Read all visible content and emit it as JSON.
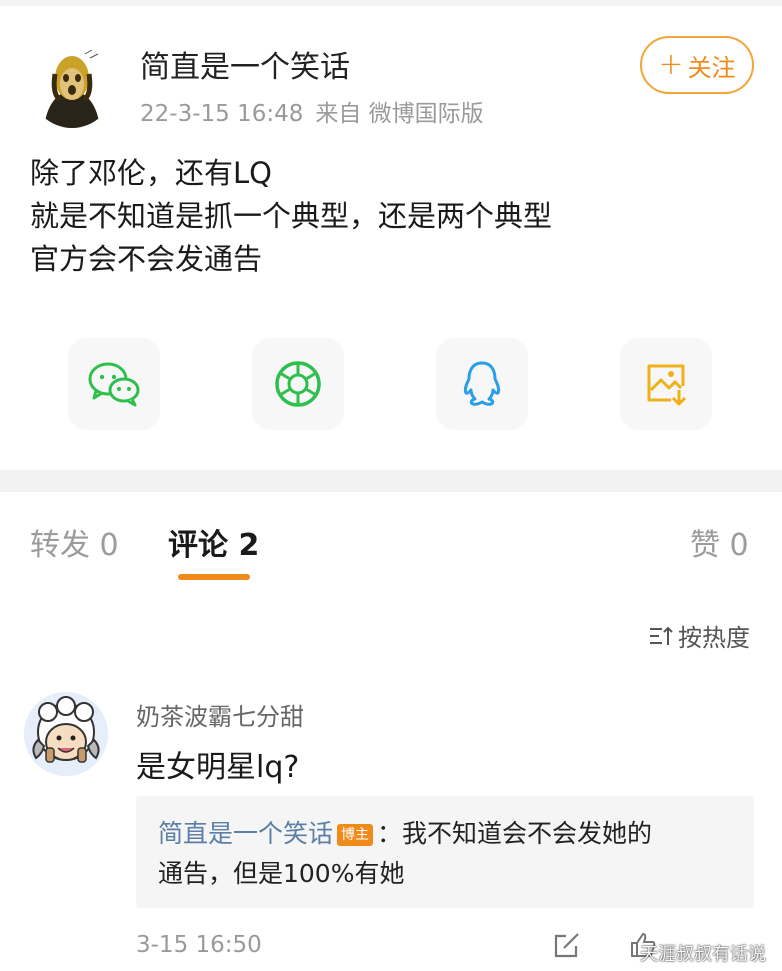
{
  "post": {
    "author": "简直是一个笑话",
    "date": "22-3-15 16:48",
    "source": "来自 微博国际版",
    "follow_label": "关注",
    "body_lines": [
      "除了邓伦，还有LQ",
      "就是不知道是抓一个典型，还是两个典型",
      "官方会不会发通告"
    ]
  },
  "share": {
    "items": [
      "wechat-icon",
      "moments-icon",
      "qq-icon",
      "save-image-icon"
    ]
  },
  "tabs": {
    "repost": "转发 0",
    "comments": "评论 2",
    "likes": "赞 0"
  },
  "sort_label": "按热度",
  "comment": {
    "user": "奶茶波霸七分甜",
    "text": "是女明星lq?",
    "reply_author": "简直是一个笑话",
    "reply_badge": "博主",
    "reply_text_1": "：我不知道会不会发她的",
    "reply_text_2": "通告，但是100%有她",
    "time": "3-15 16:50"
  },
  "watermark": "天涯叔叔有话说",
  "colors": {
    "accent": "#f08a1a",
    "wechat": "#2fbf4d",
    "qq": "#2a9ee8",
    "save": "#f0b01a",
    "reply_name": "#5b7fa6"
  }
}
